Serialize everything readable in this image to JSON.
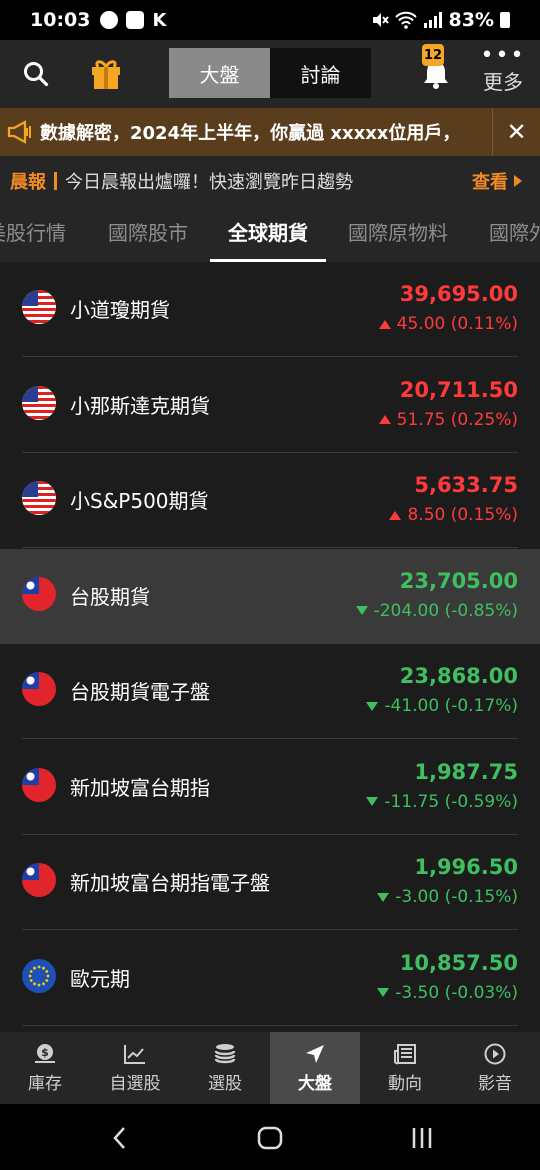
{
  "status_bar": {
    "time": "10:03",
    "k_label": "K",
    "battery": "83%"
  },
  "header": {
    "search_icon": "search-icon",
    "gift_icon": "gift-icon",
    "tabs": [
      {
        "label": "大盤",
        "active": true
      },
      {
        "label": "討論",
        "active": false
      }
    ],
    "notification_count": "12",
    "more_label": "更多"
  },
  "marquee": {
    "text": "數據解密，2024年上半年，你贏過 xxxxx位用戶，"
  },
  "morning_report": {
    "tag": "晨報",
    "text": "今日晨報出爐囉！快速瀏覽昨日趨勢",
    "view_label": "查看"
  },
  "categories": [
    {
      "label": "美股行情",
      "active": false
    },
    {
      "label": "國際股市",
      "active": false
    },
    {
      "label": "全球期貨",
      "active": true
    },
    {
      "label": "國際原物料",
      "active": false
    },
    {
      "label": "國際外",
      "active": false
    }
  ],
  "futures": [
    {
      "name": "小道瓊期貨",
      "flag": "us",
      "price": "39,695.00",
      "change": "45.00 (0.11%)",
      "direction": "up"
    },
    {
      "name": "小那斯達克期貨",
      "flag": "us",
      "price": "20,711.50",
      "change": "51.75 (0.25%)",
      "direction": "up"
    },
    {
      "name": "小S&P500期貨",
      "flag": "us",
      "price": "5,633.75",
      "change": "8.50 (0.15%)",
      "direction": "up"
    },
    {
      "name": "台股期貨",
      "flag": "tw",
      "price": "23,705.00",
      "change": "-204.00 (-0.85%)",
      "direction": "down",
      "highlighted": true
    },
    {
      "name": "台股期貨電子盤",
      "flag": "tw",
      "price": "23,868.00",
      "change": "-41.00 (-0.17%)",
      "direction": "down"
    },
    {
      "name": "新加坡富台期指",
      "flag": "tw",
      "price": "1,987.75",
      "change": "-11.75 (-0.59%)",
      "direction": "down"
    },
    {
      "name": "新加坡富台期指電子盤",
      "flag": "tw",
      "price": "1,996.50",
      "change": "-3.00 (-0.15%)",
      "direction": "down"
    },
    {
      "name": "歐元期",
      "flag": "eu",
      "price": "10,857.50",
      "change": "-3.50 (-0.03%)",
      "direction": "down"
    }
  ],
  "bottom_nav": [
    {
      "label": "庫存",
      "icon": "money-bag-icon",
      "active": false
    },
    {
      "label": "自選股",
      "icon": "chart-line-icon",
      "active": false
    },
    {
      "label": "選股",
      "icon": "coins-stack-icon",
      "active": false
    },
    {
      "label": "大盤",
      "icon": "navigation-arrow-icon",
      "active": true
    },
    {
      "label": "動向",
      "icon": "news-icon",
      "active": false
    },
    {
      "label": "影音",
      "icon": "play-icon",
      "active": false
    }
  ],
  "colors": {
    "up": "#ff3a3a",
    "down": "#3fbf5f",
    "accent": "#f08a24"
  }
}
